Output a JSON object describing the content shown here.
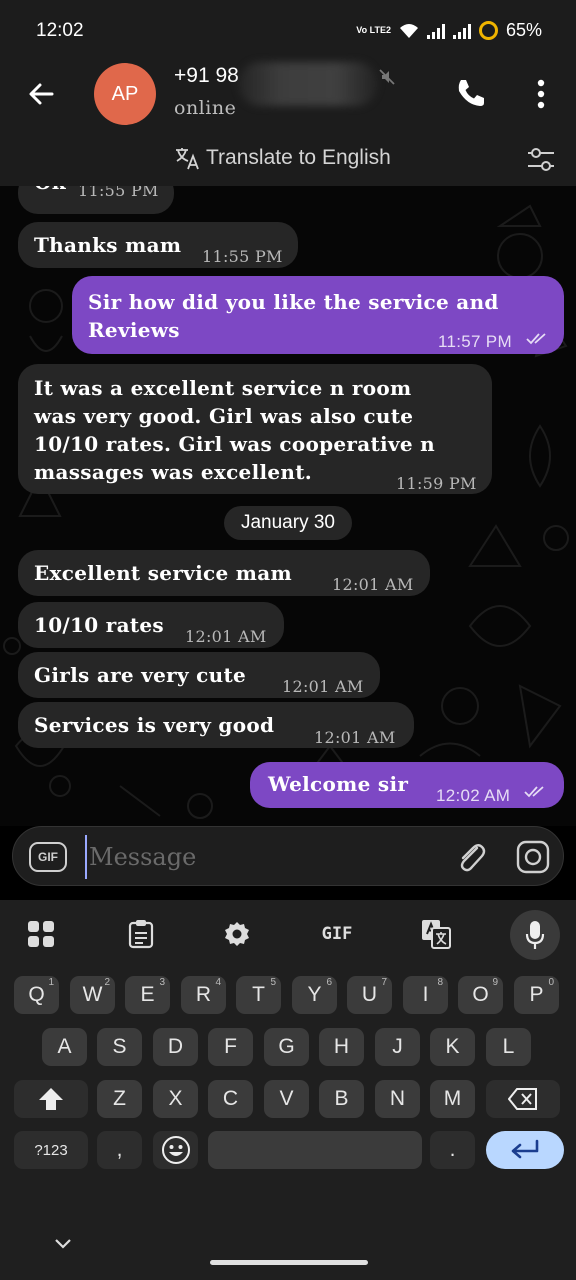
{
  "status_bar": {
    "time": "12:02",
    "network": "Vo LTE2",
    "battery": "65%"
  },
  "header": {
    "avatar_initials": "AP",
    "contact_name": "+91 98",
    "contact_status": "online"
  },
  "translate_bar": {
    "label": "Translate to English"
  },
  "messages": [
    {
      "direction": "in",
      "text": "Ok",
      "time": "11:55 PM"
    },
    {
      "direction": "in",
      "text": "Thanks mam",
      "time": "11:55 PM"
    },
    {
      "direction": "out",
      "text": "Sir how did you like the service and\nReviews",
      "time": "11:57 PM"
    },
    {
      "direction": "in",
      "text": "It was a excellent service n room\nwas very good. Girl was also cute\n10/10 rates. Girl was cooperative n\nmassages was excellent.",
      "time": "11:59 PM"
    },
    {
      "direction": "in",
      "text": "Excellent service mam",
      "time": "12:01 AM"
    },
    {
      "direction": "in",
      "text": "10/10 rates",
      "time": "12:01 AM"
    },
    {
      "direction": "in",
      "text": "Girls are very cute",
      "time": "12:01 AM"
    },
    {
      "direction": "in",
      "text": "Services is very good",
      "time": "12:01 AM"
    },
    {
      "direction": "out",
      "text": "Welcome sir",
      "time": "12:02 AM"
    }
  ],
  "date_chip": "January 30",
  "composer": {
    "gif_label": "GIF",
    "placeholder": "Message"
  },
  "keyboard": {
    "gif_label": "GIF",
    "row1": [
      {
        "key": "Q",
        "hint": "1"
      },
      {
        "key": "W",
        "hint": "2"
      },
      {
        "key": "E",
        "hint": "3"
      },
      {
        "key": "R",
        "hint": "4"
      },
      {
        "key": "T",
        "hint": "5"
      },
      {
        "key": "Y",
        "hint": "6"
      },
      {
        "key": "U",
        "hint": "7"
      },
      {
        "key": "I",
        "hint": "8"
      },
      {
        "key": "O",
        "hint": "9"
      },
      {
        "key": "P",
        "hint": "0"
      }
    ],
    "row2": [
      "A",
      "S",
      "D",
      "F",
      "G",
      "H",
      "J",
      "K",
      "L"
    ],
    "row3": [
      "Z",
      "X",
      "C",
      "V",
      "B",
      "N",
      "M"
    ],
    "symbols_label": "?123",
    "comma_label": ",",
    "period_label": "."
  },
  "colors": {
    "outgoing_bubble": "#7d48c4",
    "incoming_bubble": "#262626",
    "avatar": "#e0684b",
    "enter_key": "#b9d7ff",
    "battery_ring": "#f0b400"
  }
}
